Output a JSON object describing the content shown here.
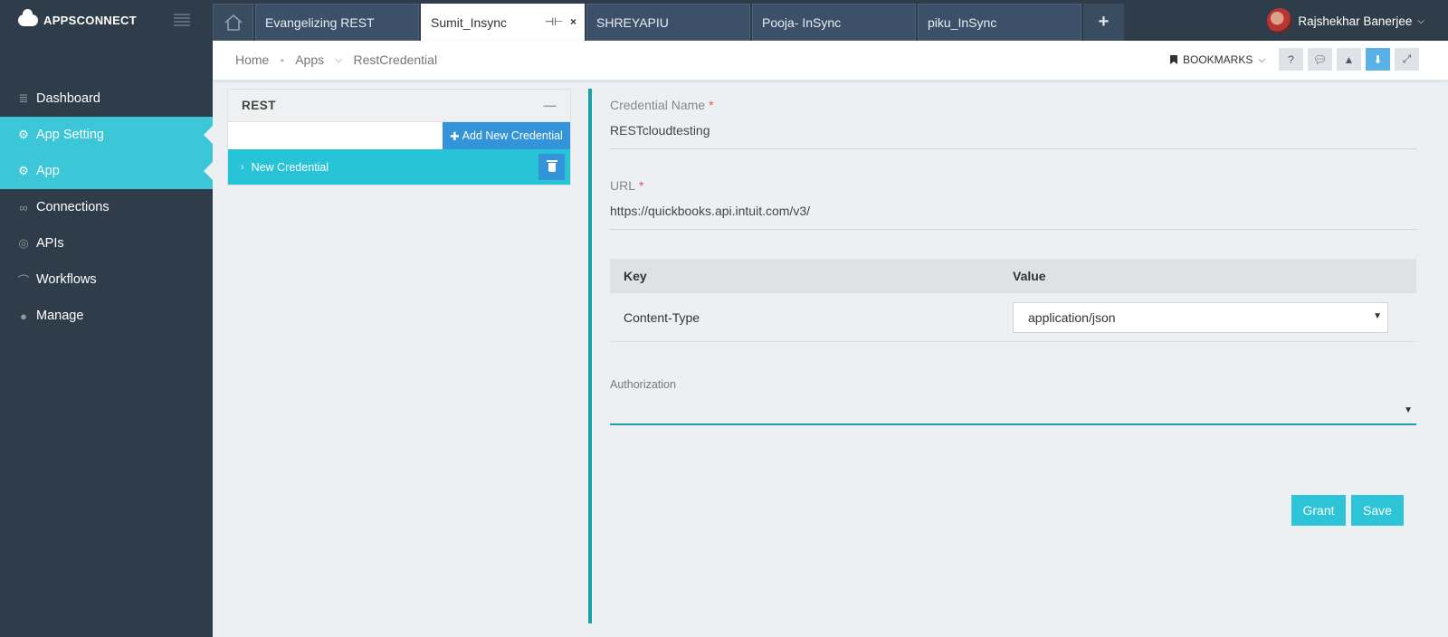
{
  "brand": {
    "name": "APPSCONNECT"
  },
  "sidebar": {
    "items": [
      {
        "label": "Dashboard",
        "icon": "database-icon",
        "active": false
      },
      {
        "label": "App Setting",
        "icon": "gear-icon",
        "active": true
      },
      {
        "label": "App",
        "icon": "gear-icon",
        "active": true
      },
      {
        "label": "Connections",
        "icon": "link-icon",
        "active": false
      },
      {
        "label": "APIs",
        "icon": "api-icon",
        "active": false
      },
      {
        "label": "Workflows",
        "icon": "workflow-icon",
        "active": false
      },
      {
        "label": "Manage",
        "icon": "chat-icon",
        "active": false
      }
    ]
  },
  "tabs": [
    {
      "label": "Evangelizing REST",
      "active": false
    },
    {
      "label": "Sumit_Insync",
      "active": true
    },
    {
      "label": "SHREYAPIU",
      "active": false
    },
    {
      "label": "Pooja- InSync",
      "active": false
    },
    {
      "label": "piku_InSync",
      "active": false
    }
  ],
  "tab_controls": {
    "pin": "⊣⊢",
    "close": "×"
  },
  "user": {
    "name": "Rajshekhar Banerjee"
  },
  "breadcrumb": {
    "home": "Home",
    "apps": "Apps",
    "current": "RestCredential"
  },
  "toolbar": {
    "bookmarks": "BOOKMARKS"
  },
  "left_panel": {
    "title": "REST",
    "add_button": "Add New Credential",
    "search_value": "",
    "credentials": [
      {
        "label": "New Credential"
      }
    ]
  },
  "form": {
    "credential_name_label": "Credential Name",
    "credential_name_value": "RESTcloudtesting",
    "url_label": "URL",
    "url_value": "https://quickbooks.api.intuit.com/v3/",
    "required_mark": "*",
    "kv_header_key": "Key",
    "kv_header_value": "Value",
    "kv_rows": [
      {
        "key": "Content-Type",
        "value": "application/json"
      }
    ],
    "authorization_label": "Authorization",
    "authorization_value": "",
    "grant_button": "Grant",
    "save_button": "Save"
  },
  "colors": {
    "sidebar": "#2f3d4a",
    "accent": "#3cc7d8",
    "primary_blue": "#3394d9",
    "divider": "#1e9ea7"
  }
}
